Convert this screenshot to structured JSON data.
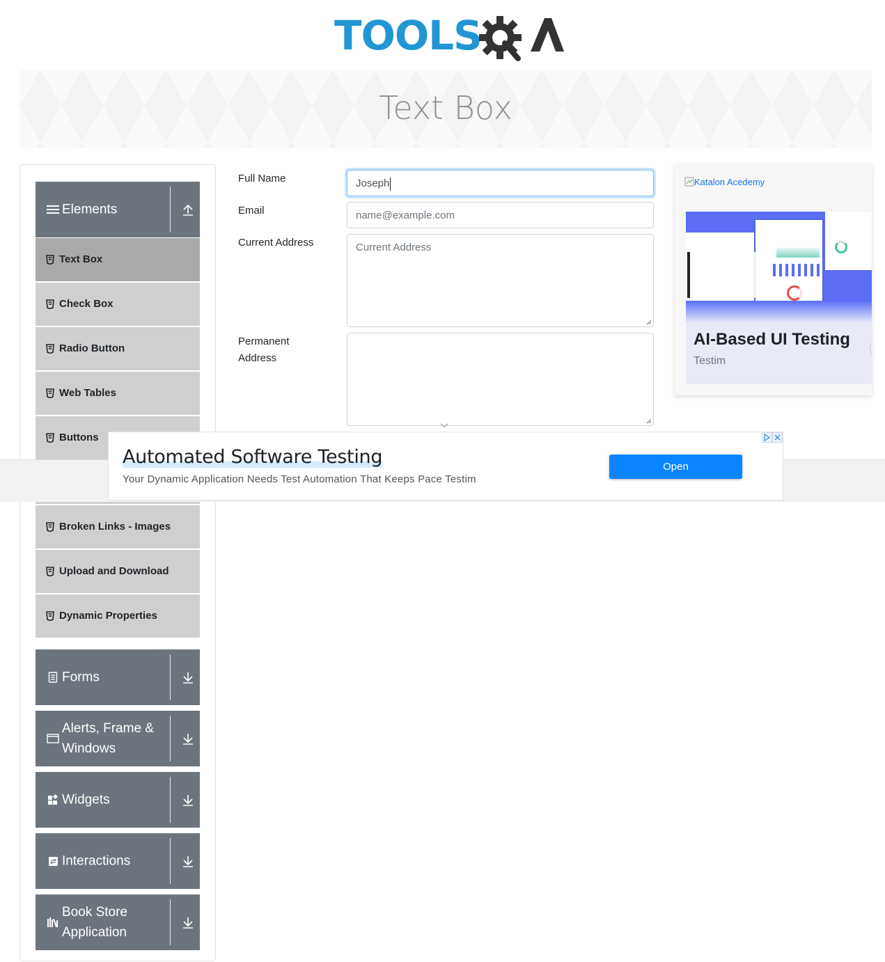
{
  "header": {
    "logo_text": "TOOLS",
    "logo_suffix": "QA",
    "banner_title": "Text Box"
  },
  "sidebar": {
    "groups": [
      {
        "label": "Elements",
        "icon": "menu-lines-icon",
        "state": "expanded"
      },
      {
        "label": "Forms",
        "icon": "document-icon",
        "state": "collapsed"
      },
      {
        "label": "Alerts, Frame & Windows",
        "icon": "browser-window-icon",
        "state": "collapsed"
      },
      {
        "label": "Widgets",
        "icon": "widgets-icon",
        "state": "collapsed"
      },
      {
        "label": "Interactions",
        "icon": "interactions-icon",
        "state": "collapsed"
      },
      {
        "label": "Book Store Application",
        "icon": "books-icon",
        "state": "collapsed"
      }
    ],
    "elements_items": [
      {
        "label": "Text Box",
        "active": true
      },
      {
        "label": "Check Box",
        "active": false
      },
      {
        "label": "Radio Button",
        "active": false
      },
      {
        "label": "Web Tables",
        "active": false
      },
      {
        "label": "Buttons",
        "active": false
      },
      {
        "label": "Broken Links - Images",
        "active": false
      },
      {
        "label": "Upload and Download",
        "active": false
      },
      {
        "label": "Dynamic Properties",
        "active": false
      }
    ]
  },
  "form": {
    "full_name": {
      "label": "Full Name",
      "value": "Joseph"
    },
    "email": {
      "label": "Email",
      "placeholder": "name@example.com"
    },
    "current_address": {
      "label": "Current Address",
      "placeholder": "Current Address"
    },
    "permanent_address": {
      "label_line1": "Permanent",
      "label_line2": "Address"
    }
  },
  "side_ad": {
    "broken_image_alt": "Katalon Acedemy",
    "title": "AI-Based UI Testing",
    "advertiser": "Testim"
  },
  "bottom_ad": {
    "headline": "Automated Software Testing",
    "description": "Your Dynamic Application Needs Test Automation That Keeps Pace Testim",
    "cta": "Open"
  },
  "colors": {
    "brand_blue": "#2196d3",
    "sidebar_group_bg": "#6c757d",
    "sidebar_item_bg": "#cfcfcf",
    "sidebar_item_active_bg": "#a9a9a9",
    "ad_button_blue": "#0a84ff"
  }
}
